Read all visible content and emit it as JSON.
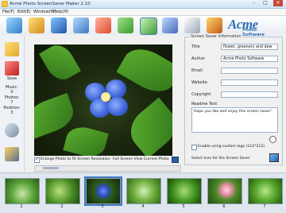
{
  "window": {
    "title": "Acme Photo ScreenSaver Maker 2.10",
    "minimize": "–",
    "maximize": "□",
    "close": "✕"
  },
  "menu": [
    {
      "label": "File(F)"
    },
    {
      "label": "Edit(E)"
    },
    {
      "label": "Window(W)"
    },
    {
      "label": "Help(H)"
    }
  ],
  "logo": {
    "brand": "Acme",
    "sub": "Photo Software"
  },
  "toolbar": {
    "buttons": [
      "open-photos",
      "add-folder",
      "transition",
      "autorun",
      "text",
      "resolution",
      "settings",
      "build",
      "edit-info",
      "wizard"
    ]
  },
  "sidebar": {
    "save_label": "Save",
    "music_label": "Music:",
    "music_value": "0",
    "photos_label": "Photos:",
    "photos_value": "7",
    "position_label": "Position:",
    "position_value": "3"
  },
  "preview": {
    "enlarge_label": "Enlarge Photo to Fit Screen Resolution",
    "enlarge_checked": true,
    "fullscreen_label": "Full Screen View Current Photo"
  },
  "info": {
    "heading": "Screen Saver Information",
    "title_label": "Title",
    "title_value": "flower, greenery and dew",
    "author_label": "Author",
    "author_value": "Acme Photo Software",
    "email_label": "Email",
    "email_value": "",
    "website_label": "Website",
    "website_value": "",
    "copyright_label": "Copyright",
    "copyright_value": "",
    "readme_label": "Readme Text",
    "readme_value": "Hope you like and enjoy this screen saver!",
    "logo_label": "Enable using custom logo (112*112)",
    "logo_checked": false,
    "icon_label": "Select Icon for the Screen Saver"
  },
  "thumbnails": [
    {
      "num": "1"
    },
    {
      "num": "2"
    },
    {
      "num": "3"
    },
    {
      "num": "4"
    },
    {
      "num": "5"
    },
    {
      "num": "6"
    },
    {
      "num": "7"
    }
  ],
  "colors": {
    "accent": "#2d6fb1",
    "selection": "#3d79c2"
  }
}
